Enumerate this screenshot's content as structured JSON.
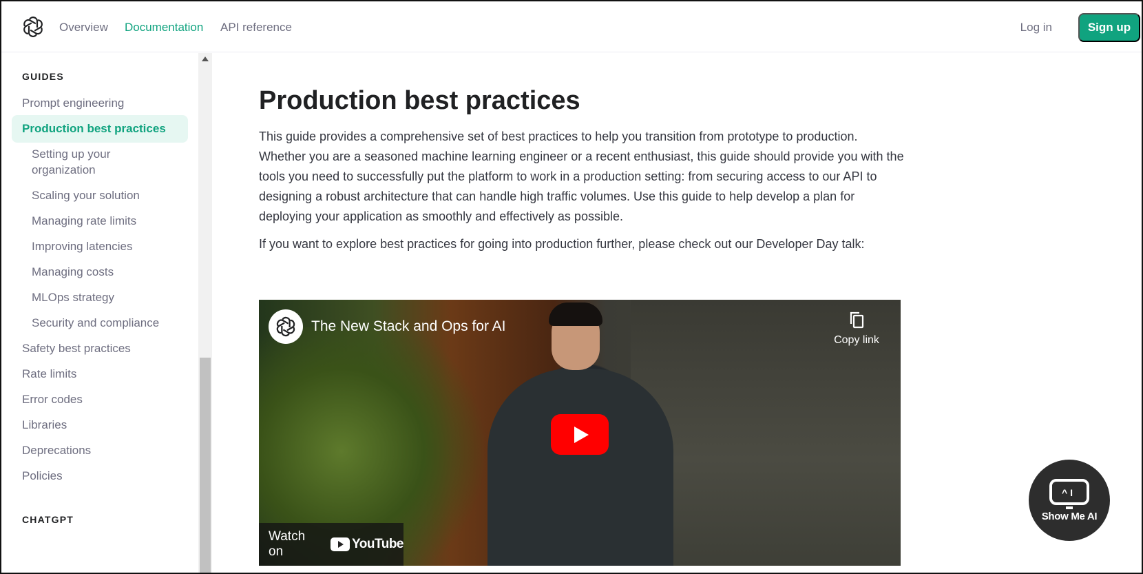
{
  "nav": {
    "links": [
      "Overview",
      "Documentation",
      "API reference"
    ],
    "active": "Documentation",
    "login": "Log in",
    "signup": "Sign up"
  },
  "sidebar": {
    "guides_heading": "GUIDES",
    "items": [
      {
        "label": "Prompt engineering"
      },
      {
        "label": "Production best practices"
      },
      {
        "label": "Setting up your"
      },
      {
        "label": "organization"
      },
      {
        "label": "Scaling your solution"
      },
      {
        "label": "Managing rate limits"
      },
      {
        "label": "Improving latencies"
      },
      {
        "label": "Managing costs"
      },
      {
        "label": "MLOps strategy"
      },
      {
        "label": "Security and compliance"
      },
      {
        "label": "Safety best practices"
      },
      {
        "label": "Rate limits"
      },
      {
        "label": "Error codes"
      },
      {
        "label": "Libraries"
      },
      {
        "label": "Deprecations"
      },
      {
        "label": "Policies"
      }
    ],
    "chatgpt_heading": "CHATGPT"
  },
  "main": {
    "title": "Production best practices",
    "paragraph1": "This guide provides a comprehensive set of best practices to help you transition from prototype to production. Whether you are a seasoned machine learning engineer or a recent enthusiast, this guide should provide you with the tools you need to successfully put the platform to work in a production setting: from securing access to our API to designing a robust architecture that can handle high traffic volumes. Use this guide to help develop a plan for deploying your application as smoothly and effectively as possible.",
    "paragraph2": "If you want to explore best practices for going into production further, please check out our Developer Day talk:"
  },
  "video": {
    "title": "The New Stack and Ops for AI",
    "copy_link": "Copy link",
    "watch_on": "Watch on",
    "youtube": "YouTube"
  },
  "badge": {
    "label": "Show Me AI"
  },
  "colors": {
    "brand": "#10a37f",
    "active_bg": "#e6f7f2",
    "text_muted": "#6e6e80"
  }
}
